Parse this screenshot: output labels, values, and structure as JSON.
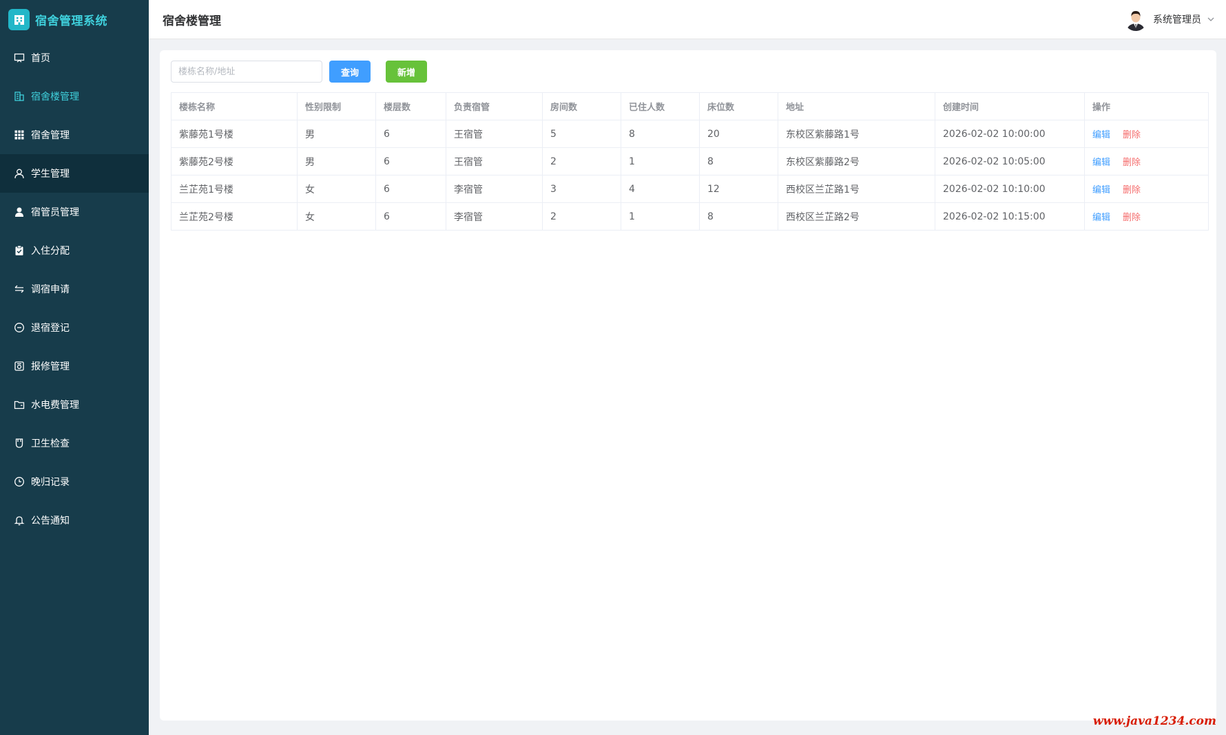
{
  "brand": {
    "title": "宿舍管理系统",
    "logo_icon": "building-icon"
  },
  "sidebar": {
    "items": [
      {
        "label": "首页",
        "icon": "home-icon",
        "name": "sidebar-item-home"
      },
      {
        "label": "宿舍楼管理",
        "icon": "building-outline-icon",
        "name": "sidebar-item-building",
        "active": true
      },
      {
        "label": "宿舍管理",
        "icon": "grid-icon",
        "name": "sidebar-item-dorm"
      },
      {
        "label": "学生管理",
        "icon": "user-outline-icon",
        "name": "sidebar-item-student",
        "highlight": true
      },
      {
        "label": "宿管员管理",
        "icon": "user-filled-icon",
        "name": "sidebar-item-manager"
      },
      {
        "label": "入住分配",
        "icon": "clipboard-check-icon",
        "name": "sidebar-item-checkin"
      },
      {
        "label": "调宿申请",
        "icon": "swap-icon",
        "name": "sidebar-item-transfer"
      },
      {
        "label": "退宿登记",
        "icon": "minus-circle-icon",
        "name": "sidebar-item-checkout"
      },
      {
        "label": "报修管理",
        "icon": "repair-icon",
        "name": "sidebar-item-repair"
      },
      {
        "label": "水电费管理",
        "icon": "folder-icon",
        "name": "sidebar-item-utility"
      },
      {
        "label": "卫生检查",
        "icon": "cup-icon",
        "name": "sidebar-item-hygiene"
      },
      {
        "label": "晚归记录",
        "icon": "clock-icon",
        "name": "sidebar-item-late"
      },
      {
        "label": "公告通知",
        "icon": "bell-icon",
        "name": "sidebar-item-notice"
      }
    ]
  },
  "header": {
    "title": "宿舍楼管理",
    "user_name": "系统管理员",
    "dropdown_icon": "chevron-down-icon"
  },
  "toolbar": {
    "search_placeholder": "楼栋名称/地址",
    "search_value": "",
    "query_label": "查询",
    "add_label": "新增"
  },
  "table": {
    "columns": [
      "楼栋名称",
      "性别限制",
      "楼层数",
      "负责宿管",
      "房间数",
      "已住人数",
      "床位数",
      "地址",
      "创建时间",
      "操作"
    ],
    "rows": [
      [
        "紫藤苑1号楼",
        "男",
        "6",
        "王宿管",
        "5",
        "8",
        "20",
        "东校区紫藤路1号",
        "2026-02-02 10:00:00"
      ],
      [
        "紫藤苑2号楼",
        "男",
        "6",
        "王宿管",
        "2",
        "1",
        "8",
        "东校区紫藤路2号",
        "2026-02-02 10:05:00"
      ],
      [
        "兰芷苑1号楼",
        "女",
        "6",
        "李宿管",
        "3",
        "4",
        "12",
        "西校区兰芷路1号",
        "2026-02-02 10:10:00"
      ],
      [
        "兰芷苑2号楼",
        "女",
        "6",
        "李宿管",
        "2",
        "1",
        "8",
        "西校区兰芷路2号",
        "2026-02-02 10:15:00"
      ]
    ],
    "edit_label": "编辑",
    "delete_label": "删除"
  },
  "watermark": "www.java1234.com",
  "colors": {
    "sidebar_bg": "#173c4b",
    "active_text": "#3fd0dc",
    "primary": "#409eff",
    "success": "#67c23a",
    "danger": "#f56c6c"
  }
}
